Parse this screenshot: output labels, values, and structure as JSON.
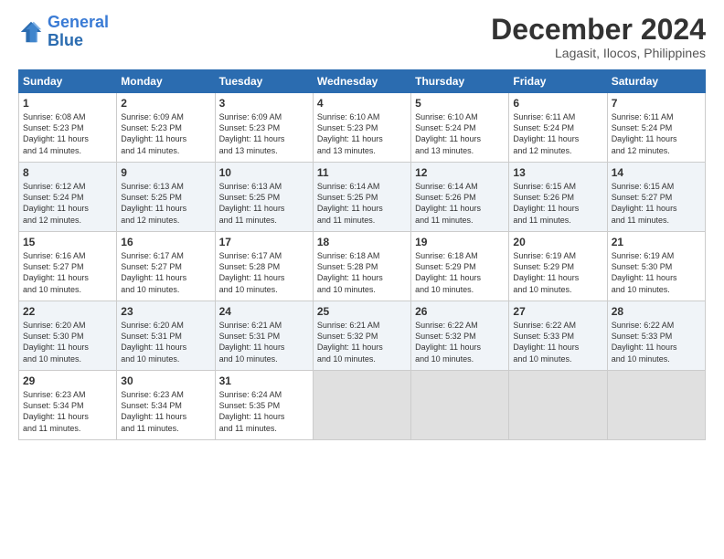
{
  "header": {
    "logo_line1": "General",
    "logo_line2": "Blue",
    "month_title": "December 2024",
    "location": "Lagasit, Ilocos, Philippines"
  },
  "calendar": {
    "days_of_week": [
      "Sunday",
      "Monday",
      "Tuesday",
      "Wednesday",
      "Thursday",
      "Friday",
      "Saturday"
    ],
    "weeks": [
      [
        {
          "day": "",
          "info": ""
        },
        {
          "day": "1",
          "info": "Sunrise: 6:08 AM\nSunset: 5:23 PM\nDaylight: 11 hours\nand 14 minutes."
        },
        {
          "day": "2",
          "info": "Sunrise: 6:09 AM\nSunset: 5:23 PM\nDaylight: 11 hours\nand 14 minutes."
        },
        {
          "day": "3",
          "info": "Sunrise: 6:09 AM\nSunset: 5:23 PM\nDaylight: 11 hours\nand 13 minutes."
        },
        {
          "day": "4",
          "info": "Sunrise: 6:10 AM\nSunset: 5:23 PM\nDaylight: 11 hours\nand 13 minutes."
        },
        {
          "day": "5",
          "info": "Sunrise: 6:10 AM\nSunset: 5:24 PM\nDaylight: 11 hours\nand 13 minutes."
        },
        {
          "day": "6",
          "info": "Sunrise: 6:11 AM\nSunset: 5:24 PM\nDaylight: 11 hours\nand 12 minutes."
        },
        {
          "day": "7",
          "info": "Sunrise: 6:11 AM\nSunset: 5:24 PM\nDaylight: 11 hours\nand 12 minutes."
        }
      ],
      [
        {
          "day": "8",
          "info": "Sunrise: 6:12 AM\nSunset: 5:24 PM\nDaylight: 11 hours\nand 12 minutes."
        },
        {
          "day": "9",
          "info": "Sunrise: 6:13 AM\nSunset: 5:25 PM\nDaylight: 11 hours\nand 12 minutes."
        },
        {
          "day": "10",
          "info": "Sunrise: 6:13 AM\nSunset: 5:25 PM\nDaylight: 11 hours\nand 11 minutes."
        },
        {
          "day": "11",
          "info": "Sunrise: 6:14 AM\nSunset: 5:25 PM\nDaylight: 11 hours\nand 11 minutes."
        },
        {
          "day": "12",
          "info": "Sunrise: 6:14 AM\nSunset: 5:26 PM\nDaylight: 11 hours\nand 11 minutes."
        },
        {
          "day": "13",
          "info": "Sunrise: 6:15 AM\nSunset: 5:26 PM\nDaylight: 11 hours\nand 11 minutes."
        },
        {
          "day": "14",
          "info": "Sunrise: 6:15 AM\nSunset: 5:27 PM\nDaylight: 11 hours\nand 11 minutes."
        }
      ],
      [
        {
          "day": "15",
          "info": "Sunrise: 6:16 AM\nSunset: 5:27 PM\nDaylight: 11 hours\nand 10 minutes."
        },
        {
          "day": "16",
          "info": "Sunrise: 6:17 AM\nSunset: 5:27 PM\nDaylight: 11 hours\nand 10 minutes."
        },
        {
          "day": "17",
          "info": "Sunrise: 6:17 AM\nSunset: 5:28 PM\nDaylight: 11 hours\nand 10 minutes."
        },
        {
          "day": "18",
          "info": "Sunrise: 6:18 AM\nSunset: 5:28 PM\nDaylight: 11 hours\nand 10 minutes."
        },
        {
          "day": "19",
          "info": "Sunrise: 6:18 AM\nSunset: 5:29 PM\nDaylight: 11 hours\nand 10 minutes."
        },
        {
          "day": "20",
          "info": "Sunrise: 6:19 AM\nSunset: 5:29 PM\nDaylight: 11 hours\nand 10 minutes."
        },
        {
          "day": "21",
          "info": "Sunrise: 6:19 AM\nSunset: 5:30 PM\nDaylight: 11 hours\nand 10 minutes."
        }
      ],
      [
        {
          "day": "22",
          "info": "Sunrise: 6:20 AM\nSunset: 5:30 PM\nDaylight: 11 hours\nand 10 minutes."
        },
        {
          "day": "23",
          "info": "Sunrise: 6:20 AM\nSunset: 5:31 PM\nDaylight: 11 hours\nand 10 minutes."
        },
        {
          "day": "24",
          "info": "Sunrise: 6:21 AM\nSunset: 5:31 PM\nDaylight: 11 hours\nand 10 minutes."
        },
        {
          "day": "25",
          "info": "Sunrise: 6:21 AM\nSunset: 5:32 PM\nDaylight: 11 hours\nand 10 minutes."
        },
        {
          "day": "26",
          "info": "Sunrise: 6:22 AM\nSunset: 5:32 PM\nDaylight: 11 hours\nand 10 minutes."
        },
        {
          "day": "27",
          "info": "Sunrise: 6:22 AM\nSunset: 5:33 PM\nDaylight: 11 hours\nand 10 minutes."
        },
        {
          "day": "28",
          "info": "Sunrise: 6:22 AM\nSunset: 5:33 PM\nDaylight: 11 hours\nand 10 minutes."
        }
      ],
      [
        {
          "day": "29",
          "info": "Sunrise: 6:23 AM\nSunset: 5:34 PM\nDaylight: 11 hours\nand 11 minutes."
        },
        {
          "day": "30",
          "info": "Sunrise: 6:23 AM\nSunset: 5:34 PM\nDaylight: 11 hours\nand 11 minutes."
        },
        {
          "day": "31",
          "info": "Sunrise: 6:24 AM\nSunset: 5:35 PM\nDaylight: 11 hours\nand 11 minutes."
        },
        {
          "day": "",
          "info": ""
        },
        {
          "day": "",
          "info": ""
        },
        {
          "day": "",
          "info": ""
        },
        {
          "day": "",
          "info": ""
        }
      ]
    ]
  }
}
